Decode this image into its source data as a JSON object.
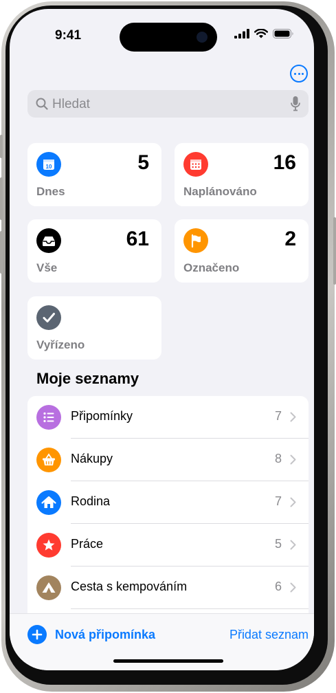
{
  "status": {
    "time": "9:41"
  },
  "search": {
    "placeholder": "Hledat"
  },
  "smart_lists": [
    {
      "label": "Dnes",
      "count": "5",
      "icon": "calendar-today-icon",
      "color": "#0a7aff"
    },
    {
      "label": "Naplánováno",
      "count": "16",
      "icon": "calendar-icon",
      "color": "#ff3b30"
    },
    {
      "label": "Vše",
      "count": "61",
      "icon": "tray-icon",
      "color": "#000000"
    },
    {
      "label": "Označeno",
      "count": "2",
      "icon": "flag-icon",
      "color": "#ff9500"
    },
    {
      "label": "Vyřízeno",
      "count": "",
      "icon": "checkmark-icon",
      "color": "#5b6572"
    }
  ],
  "my_lists": {
    "title": "Moje seznamy",
    "items": [
      {
        "name": "Připomínky",
        "count": "7",
        "icon": "list-bullet-icon",
        "color": "#b86fe0"
      },
      {
        "name": "Nákupy",
        "count": "8",
        "icon": "basket-icon",
        "color": "#ff9500"
      },
      {
        "name": "Rodina",
        "count": "7",
        "icon": "house-icon",
        "color": "#0a7aff"
      },
      {
        "name": "Práce",
        "count": "5",
        "icon": "star-icon",
        "color": "#ff3b30"
      },
      {
        "name": "Cesta s kempováním",
        "count": "6",
        "icon": "tent-icon",
        "color": "#a2845e"
      }
    ]
  },
  "toolbar": {
    "new_reminder": "Nová připomínka",
    "add_list": "Přidat seznam"
  },
  "accent_color": "#0a7aff"
}
